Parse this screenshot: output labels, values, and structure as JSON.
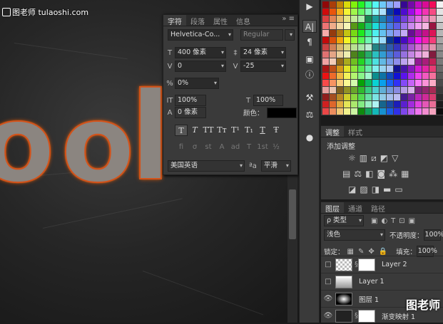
{
  "watermark_top": "图老师 tulaoshi.com",
  "watermark_bottom": "图老师",
  "canvas_text": [
    "o",
    "o",
    "l"
  ],
  "char_panel": {
    "tabs": [
      "字符",
      "段落",
      "属性",
      "信息"
    ],
    "font_family": "Helvetica-Co...",
    "font_style": "Regular",
    "font_size": "400 像素",
    "leading": "24 像素",
    "kerning": "0",
    "tracking": "-25",
    "scale_tsume": "0%",
    "vertical_scale": "100%",
    "horizontal_scale": "100%",
    "baseline_shift": "0 像素",
    "color_label": "颜色：",
    "style_buttons": [
      "T",
      "T",
      "TT",
      "Tт",
      "T¹",
      "T₁",
      "T",
      "Ŧ"
    ],
    "ot_buttons": [
      "fi",
      "σ",
      "st",
      "A",
      "ad",
      "T",
      "1st",
      "½"
    ],
    "language": "美国英语",
    "aa_label": "ªa",
    "aa_method": "平滑"
  },
  "adjustments": {
    "tabs": [
      "调整",
      "样式"
    ],
    "title": "添加调整"
  },
  "layers": {
    "tabs": [
      "图层",
      "通道",
      "路径"
    ],
    "filter": "ρ 类型",
    "blend_mode": "浅色",
    "opacity_label": "不透明度：",
    "opacity": "100%",
    "lock_label": "锁定：",
    "fill_label": "填充：",
    "fill": "100%",
    "items": [
      {
        "name": "Layer 2",
        "visible": false
      },
      {
        "name": "Layer 1",
        "visible": false
      },
      {
        "name": "图层 1",
        "visible": true
      },
      {
        "name": "渐变映射 1",
        "visible": true
      }
    ]
  },
  "colors": {
    "accent": "#d3521a",
    "panel": "#3a3a3a"
  }
}
